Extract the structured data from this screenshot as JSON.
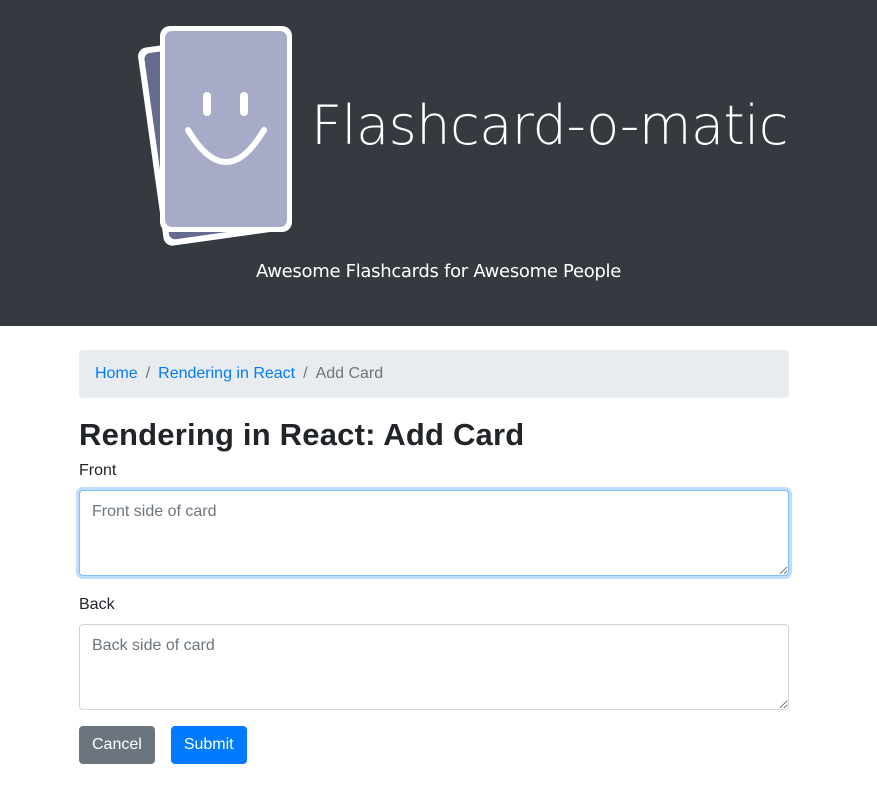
{
  "header": {
    "title": "Flashcard-o-matic",
    "tagline": "Awesome Flashcards for Awesome People",
    "logo_icon": "smiley-flashcard-icon",
    "background_color": "#343a40"
  },
  "breadcrumb": {
    "home": "Home",
    "deck": "Rendering in React",
    "current": "Add Card",
    "separator": "/"
  },
  "page": {
    "title": "Rendering in React: Add Card"
  },
  "form": {
    "front_label": "Front",
    "front_placeholder": "Front side of card",
    "front_value": "",
    "back_label": "Back",
    "back_placeholder": "Back side of card",
    "back_value": ""
  },
  "buttons": {
    "cancel": "Cancel",
    "submit": "Submit"
  },
  "colors": {
    "primary": "#007bff",
    "secondary": "#6c757d",
    "breadcrumb_bg": "#e9ecef"
  }
}
